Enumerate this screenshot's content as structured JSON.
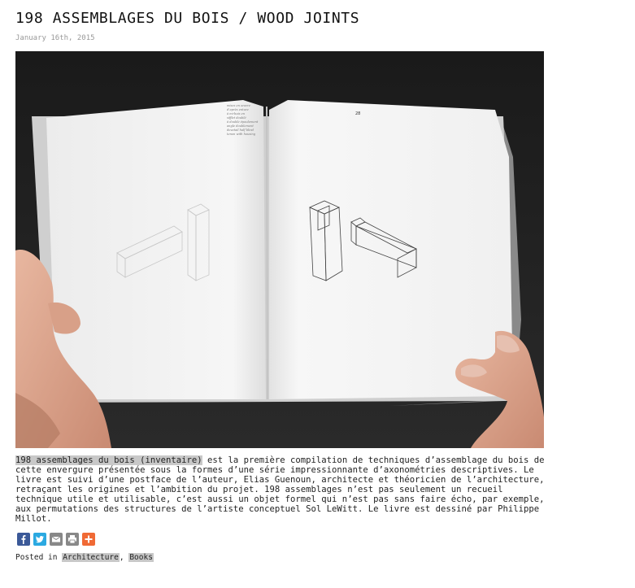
{
  "post": {
    "title": "198 ASSEMBLAGES DU BOIS / WOOD JOINTS",
    "date": "January 16th, 2015",
    "image_alt": "Photo of an open book showing axonometric drawings of wood joints",
    "body_link": "198 assemblages du bois (inventaire)",
    "body_text": " est la première compilation de techniques d’assemblage du bois de cette envergure présentée sous la formes d’une série impressionnante d’axonométries descriptives. Le livre est suivi d’une postface de l’auteur, Elias Guenoun, architecte et théoricien de l’architecture, retraçant les origines et l’ambition du projet. 198 assemblages n’est pas seulement un recueil technique utile et utilisable, c’est aussi un objet formel qui n’est pas sans faire écho, par exemple, aux permutations des structures de l’artiste conceptuel Sol LeWitt. Le livre est dessiné par Philippe Millot.",
    "book_page_number": "28"
  },
  "share": {
    "buttons": [
      {
        "name": "facebook-icon",
        "color": "#3b5998"
      },
      {
        "name": "twitter-icon",
        "color": "#2ba9e1"
      },
      {
        "name": "email-icon",
        "color": "#888888"
      },
      {
        "name": "print-icon",
        "color": "#888888"
      },
      {
        "name": "more-icon",
        "color": "#f06a35"
      }
    ]
  },
  "footer": {
    "posted_in_label": "Posted in",
    "separator": ",",
    "categories": [
      "Architecture",
      "Books"
    ]
  }
}
